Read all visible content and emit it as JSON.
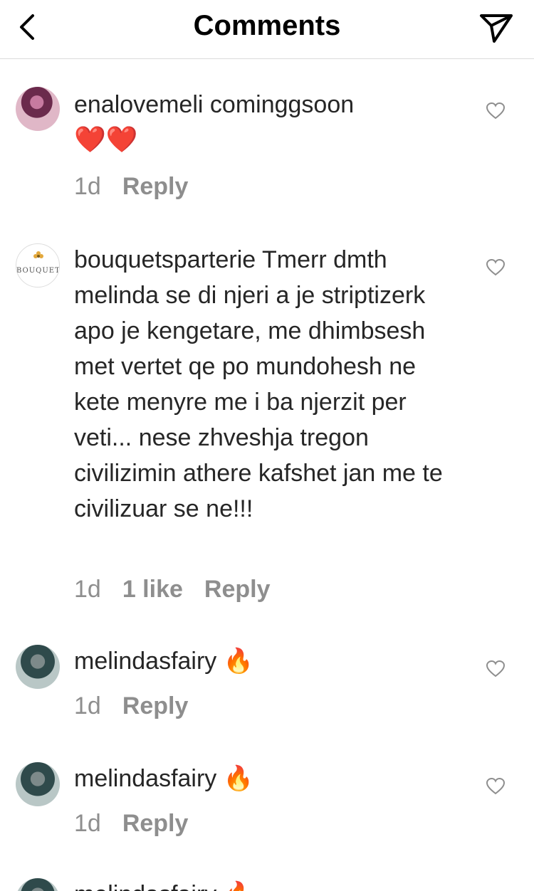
{
  "header": {
    "title": "Comments"
  },
  "comments": [
    {
      "username": "enalovemeli",
      "text": "cominggsoon",
      "emoji": "❤️❤️",
      "time": "1d",
      "likes": "",
      "reply": "Reply"
    },
    {
      "username": "bouquetsparterie",
      "logo_text": "BOUQUET",
      "text": "Tmerr dmth melinda se di njeri a je striptizerk apo je kengetare, me dhimbsesh met vertet qe po mundohesh ne kete menyre me i ba njerzit per veti... nese zhveshja tregon civilizimin athere kafshet jan me te civilizuar se ne!!!",
      "time": "1d",
      "likes": "1 like",
      "reply": "Reply"
    },
    {
      "username": "melindasfairy",
      "text": "",
      "emoji": "🔥",
      "time": "1d",
      "likes": "",
      "reply": "Reply"
    },
    {
      "username": "melindasfairy",
      "text": "",
      "emoji": "🔥",
      "time": "1d",
      "likes": "",
      "reply": "Reply"
    },
    {
      "username": "melindasfairy",
      "text": "",
      "emoji": "🔥",
      "time": "",
      "likes": "",
      "reply": ""
    }
  ],
  "colors": {
    "text": "#262626",
    "meta": "#8e8e8e",
    "divider": "#dbdbdb"
  }
}
